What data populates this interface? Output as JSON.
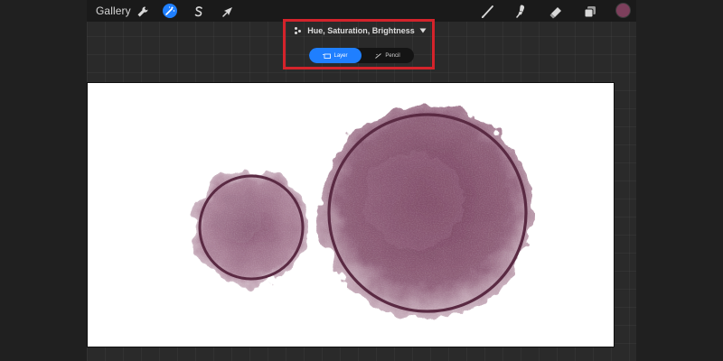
{
  "toolbar": {
    "gallery_label": "Gallery",
    "left_tools": [
      {
        "icon": "wrench-icon",
        "name": "actions"
      },
      {
        "icon": "magic-wand-icon",
        "name": "adjustments",
        "active": true
      },
      {
        "icon": "s-selection-icon",
        "name": "selection"
      },
      {
        "icon": "arrow-transform-icon",
        "name": "transform"
      }
    ],
    "right_tools": [
      {
        "icon": "brush-icon",
        "name": "brush"
      },
      {
        "icon": "smudge-icon",
        "name": "smudge"
      },
      {
        "icon": "eraser-icon",
        "name": "eraser"
      },
      {
        "icon": "layers-icon",
        "name": "layers"
      }
    ],
    "active_color": "#7d3f5c"
  },
  "adjustment": {
    "title": "Hue, Saturation, Brightness",
    "modes": [
      {
        "label": "Layer",
        "active": true
      },
      {
        "label": "Pencil",
        "active": false
      }
    ]
  },
  "colors": {
    "accent": "#1f7fff",
    "highlight": "#d4232b",
    "paint": "#6e3552"
  }
}
